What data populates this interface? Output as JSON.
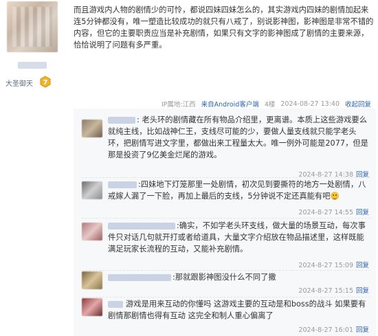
{
  "user": {
    "title": "大圣御天",
    "level": "7"
  },
  "post": {
    "text": "而且游戏内人物的剧情少的可怜，都说四妹四妹怎么的，其实游戏内四妹的剧情加起来连5分钟都没有，唯一塑造比较成功的就只有八戒了，别说影神图，影神图是非常不错的内容，但它的主要职责应当是补充剧情，如果只有文字的影神图成了剧情的主要来源，恰恰说明了问题有多严重。",
    "ip": "IP属地:江西",
    "device": "来自Android客户端",
    "floor": "4楼",
    "time": "2024-08-27 13:40",
    "reply_label": "收起回复"
  },
  "replies": [
    {
      "text": ": 老头环的剧情藏在所有物品介绍里，更离谱。本质上这些游戏要么就纯主线，比如战神仁王，支线尽可能的少，要做人量支线就只能学老头环，把剧情写进文字里，都做出来工程量太大。唯一例外可能是2077，但是那是投资了9亿美金烂尾的游戏。",
      "time": "2024-8-27 14:38",
      "reply_btn": "回复"
    },
    {
      "text": ":四妹地下灯笼那里一处剧情，初次见到要撕符的地方一处剧情，八戒嫁人漏了一下脸，再加上最后的支线，5分钟说不定还真能有吧",
      "time": "2024-8-27 14:55",
      "reply_btn": "回复"
    },
    {
      "text": ":确实，不如学老头环支线，做大量的场景互动，每次事件只对话几句就开打或者给道具，大量文字介绍放在物品描述里，这样既能满足玩家长流程的互动，又能补充剧情。",
      "time": "2024-8-27 15:09",
      "reply_btn": "回复"
    },
    {
      "text": ":那就跟影神图没什么不同了撒",
      "time": "2024-8-27 15:15",
      "reply_btn": "回复"
    },
    {
      "text": "游戏是用来互动的你懂吗 这游戏主要的互动是和boss的战斗 如果要有剧情那剧情也得有互动 这完全和制人重心偏离了",
      "time": "2024-8-27 16:01",
      "reply_btn": "回复"
    }
  ]
}
